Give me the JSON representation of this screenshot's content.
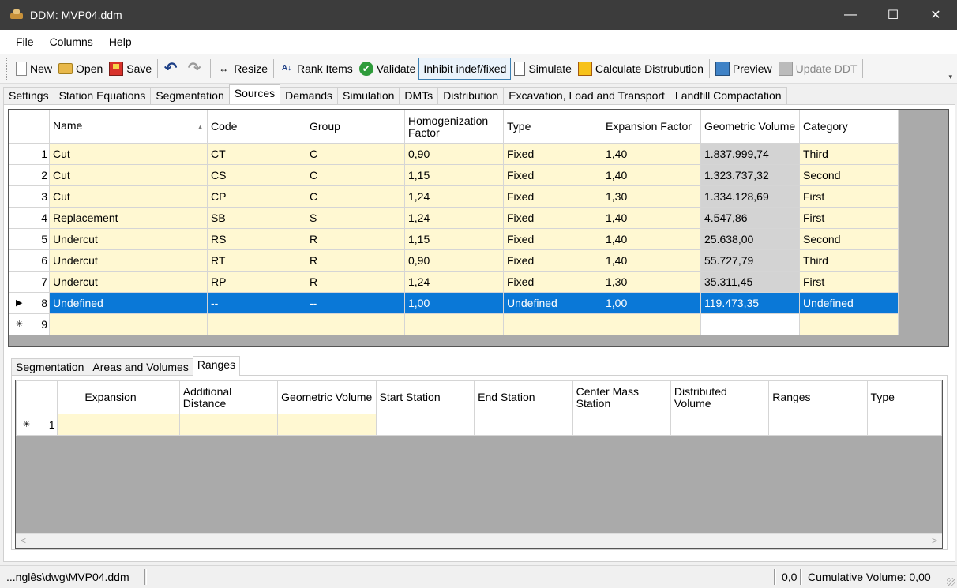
{
  "window": {
    "title": "DDM: MVP04.ddm",
    "minimize": "—",
    "maximize": "☐",
    "close": "✕"
  },
  "menu": [
    "File",
    "Columns",
    "Help"
  ],
  "toolbar": {
    "new": "New",
    "open": "Open",
    "save": "Save",
    "undo_icon": "↶",
    "redo_icon": "↷",
    "resize_icon": "↔",
    "resize": "Resize",
    "rank_icon": "A↓",
    "rank": "Rank Items",
    "validate_icon": "✔",
    "validate": "Validate",
    "inhibit": "Inhibit indef/fixed",
    "simulate": "Simulate",
    "calculate": "Calculate Distrubution",
    "preview": "Preview",
    "update": "Update DDT",
    "more": "▾"
  },
  "tabs": [
    "Settings",
    "Station Equations",
    "Segmentation",
    "Sources",
    "Demands",
    "Simulation",
    "DMTs",
    "Distribution",
    "Excavation, Load and Transport",
    "Landfill Compactation"
  ],
  "sources_grid": {
    "columns": [
      "Name",
      "Code",
      "Group",
      "Homogenization Factor",
      "Type",
      "Expansion Factor",
      "Geometric Volume",
      "Category"
    ],
    "sort_arrow": "▲",
    "rows": [
      [
        "Cut",
        "CT",
        "C",
        "0,90",
        "Fixed",
        "1,40",
        "1.837.999,74",
        "Third"
      ],
      [
        "Cut",
        "CS",
        "C",
        "1,15",
        "Fixed",
        "1,40",
        "1.323.737,32",
        "Second"
      ],
      [
        "Cut",
        "CP",
        "C",
        "1,24",
        "Fixed",
        "1,30",
        "1.334.128,69",
        "First"
      ],
      [
        "Replacement",
        "SB",
        "S",
        "1,24",
        "Fixed",
        "1,40",
        "4.547,86",
        "First"
      ],
      [
        "Undercut",
        "RS",
        "R",
        "1,15",
        "Fixed",
        "1,40",
        "25.638,00",
        "Second"
      ],
      [
        "Undercut",
        "RT",
        "R",
        "0,90",
        "Fixed",
        "1,40",
        "55.727,79",
        "Third"
      ],
      [
        "Undercut",
        "RP",
        "R",
        "1,24",
        "Fixed",
        "1,30",
        "35.311,45",
        "First"
      ],
      [
        "Undefined",
        "--",
        "--",
        "1,00",
        "Undefined",
        "1,00",
        "119.473,35",
        "Undefined"
      ]
    ],
    "row_numbers": [
      "1",
      "2",
      "3",
      "4",
      "5",
      "6",
      "7",
      "8",
      "9"
    ],
    "current_marker": "▶",
    "new_marker": "✳"
  },
  "lower_tabs": [
    "Segmentation",
    "Areas and Volumes",
    "Ranges"
  ],
  "ranges_grid": {
    "columns": [
      "",
      "Expansion",
      "Additional Distance",
      "Geometric Volume",
      "Start Station",
      "End Station",
      "Center Mass Station",
      "Distributed Volume",
      "Ranges",
      "Type"
    ],
    "row_number": "1",
    "new_marker": "✳",
    "scroll_left": "<",
    "scroll_right": ">"
  },
  "status": {
    "path": "...nglês\\dwg\\MVP04.ddm",
    "value": "0,0",
    "cumulative": "Cumulative Volume: 0,00"
  }
}
